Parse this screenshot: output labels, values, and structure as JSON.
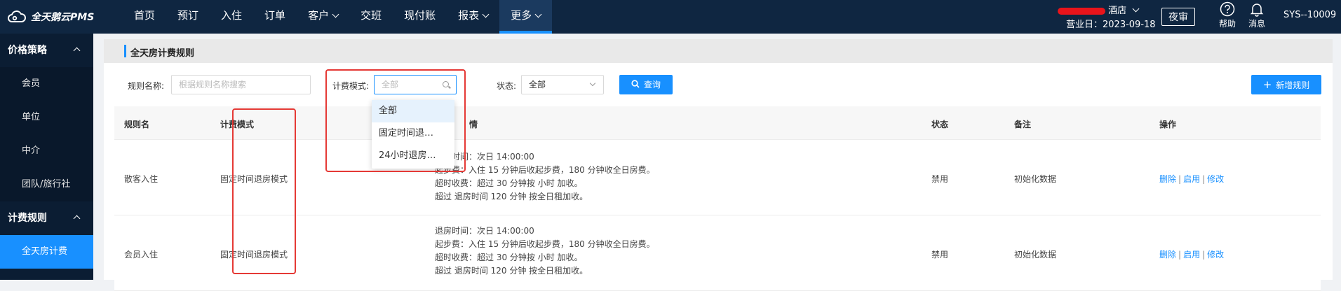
{
  "app": {
    "name": "全天鹅云PMS"
  },
  "nav": {
    "items": [
      {
        "label": "首页"
      },
      {
        "label": "预订"
      },
      {
        "label": "入住"
      },
      {
        "label": "订单"
      },
      {
        "label": "客户",
        "has_caret": true
      },
      {
        "label": "交班"
      },
      {
        "label": "现付账"
      },
      {
        "label": "报表",
        "has_caret": true
      },
      {
        "label": "更多",
        "has_caret": true,
        "active": true
      }
    ]
  },
  "header": {
    "hotel_suffix": "酒店",
    "business_date": "营业日：2023-09-18",
    "night_audit": "夜审",
    "help": "帮助",
    "messages": "消息",
    "user": "SYS--10009"
  },
  "sidebar": {
    "groups": [
      {
        "label": "价格策略",
        "items": [
          "会员",
          "单位",
          "中介",
          "团队/旅行社"
        ]
      },
      {
        "label": "计费规则",
        "items": [
          "全天房计费"
        ]
      }
    ],
    "active_item": "全天房计费"
  },
  "page": {
    "title": "全天房计费规则",
    "filters": {
      "rule_name_label": "规则名称:",
      "rule_name_placeholder": "根据规则名称搜索",
      "mode_label": "计费模式:",
      "mode_placeholder": "全部",
      "status_label": "状态:",
      "status_value": "全部",
      "query_button": "查询",
      "add_button": "新增规则"
    },
    "dropdown_options": [
      "全部",
      "固定时间退…",
      "24小时退房…"
    ],
    "table": {
      "headers": [
        "规则名",
        "计费模式",
        "情",
        "状态",
        "备注",
        "操作"
      ],
      "rows": [
        {
          "name": "散客入住",
          "mode": "固定时间退房模式",
          "detail": [
            "退房时间：次日 14:00:00",
            "起步费：入住 15 分钟后收起步费，180 分钟收全日房费。",
            "超时收费：超过 30 分钟按 小时 加收。",
            "超过 退房时间 120 分钟 按全日租加收。"
          ],
          "status": "禁用",
          "remark": "初始化数据",
          "ops": [
            "删除",
            "启用",
            "修改"
          ]
        },
        {
          "name": "会员入住",
          "mode": "固定时间退房模式",
          "detail": [
            "退房时间：次日 14:00:00",
            "起步费：入住 15 分钟后收起步费，180 分钟收全日房费。",
            "超时收费：超过 30 分钟按 小时 加收。",
            "超过 退房时间 120 分钟 按全日租加收。"
          ],
          "status": "禁用",
          "remark": "初始化数据",
          "ops": [
            "删除",
            "启用",
            "修改"
          ]
        }
      ]
    }
  },
  "colors": {
    "topbar": "#0f2641",
    "accent": "#1890ff",
    "highlight": "#e53935"
  }
}
